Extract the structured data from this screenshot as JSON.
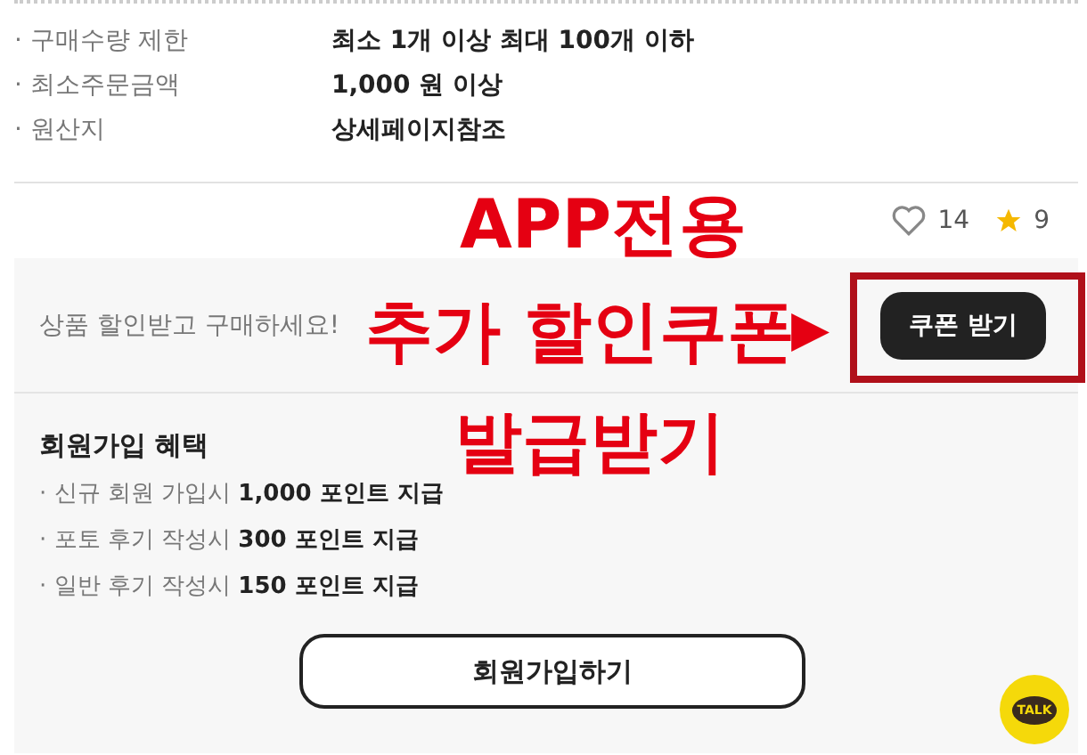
{
  "info_rows": [
    {
      "label": "· 구매수량 제한",
      "value": "최소 1개 이상 최대 100개 이하"
    },
    {
      "label": "· 최소주문금액",
      "value": "1,000 원 이상"
    },
    {
      "label": "· 원산지",
      "value": "상세페이지참조"
    }
  ],
  "stats": {
    "likes": "14",
    "rating": "9"
  },
  "coupon": {
    "text": "상품 할인받고 구매하세요!",
    "button": "쿠폰 받기"
  },
  "benefits": {
    "title": "회원가입 혜택",
    "items": [
      {
        "label": "· 신규 회원 가입시 ",
        "value": "1,000 포인트 지급"
      },
      {
        "label": "· 포토 후기 작성시 ",
        "value": "300 포인트 지급"
      },
      {
        "label": "· 일반 후기 작성시 ",
        "value": "150 포인트 지급"
      }
    ],
    "button": "회원가입하기"
  },
  "chat": {
    "label": "TALK"
  },
  "annotations": {
    "top": "APP전용",
    "middle": "추가 할인쿠폰",
    "arrow": "▶",
    "bottom": "발급받기"
  }
}
